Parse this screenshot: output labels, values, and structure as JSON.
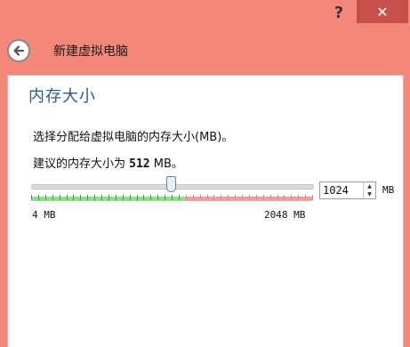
{
  "titlebar": {
    "help_label": "?",
    "close_label": "✕"
  },
  "header": {
    "title": "新建虚拟电脑",
    "back_icon": "arrow-left-icon"
  },
  "page": {
    "heading": "内存大小",
    "description": "选择分配给虚拟电脑的内存大小(MB)。",
    "recommend_prefix": "建议的内存大小为 ",
    "recommend_value": "512",
    "recommend_suffix": " MB。"
  },
  "memory": {
    "value": "1024",
    "unit": "MB",
    "min_label": "4 MB",
    "max_label": "2048 MB",
    "min_mb": 4,
    "max_mb": 2048,
    "current_mb": 1024,
    "recommended_max_mb": 1126
  },
  "colors": {
    "window": "#f3877a",
    "heading": "#2a5a8e",
    "recommended_zone": "#8fe08a",
    "warning_zone": "#f2a0a0",
    "close_button": "#c7504a"
  }
}
